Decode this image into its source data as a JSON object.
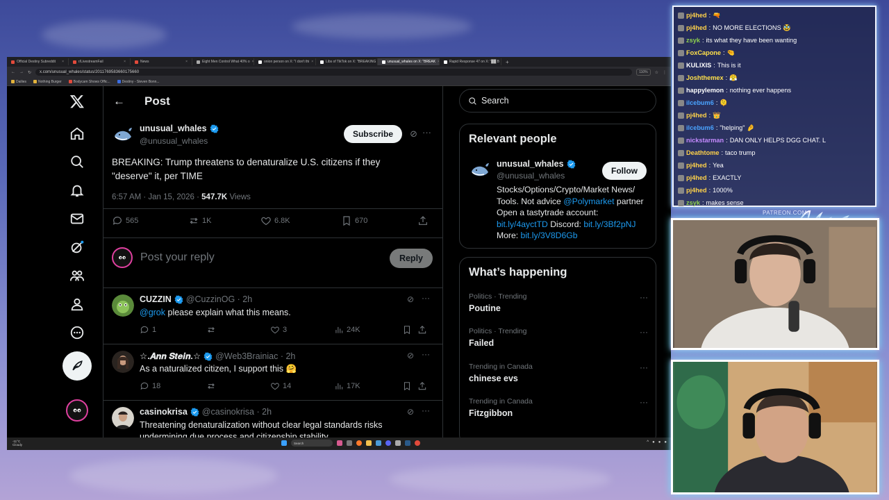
{
  "browser": {
    "tabs": [
      {
        "label": "Official Destiny Subreddit"
      },
      {
        "label": "r/LivestreamFail"
      },
      {
        "label": "News"
      },
      {
        "label": "Eight Men Control What 40% o"
      },
      {
        "label": "onion person on X: \"I don't thi"
      },
      {
        "label": "Libs of TikTok on X: \"BREAKING"
      },
      {
        "label": "unusual_whales on X: \"BREAK"
      },
      {
        "label": "Rapid Response 47 on X: \"██ B"
      }
    ],
    "url": "x.com/unusual_whales/status/2011769583660175660",
    "zoom": "110%",
    "bookmarks": [
      "Dailies",
      "Nothing Burger",
      "Bodycam Shows Offic...",
      "Destiny - Steven Bonn..."
    ]
  },
  "x": {
    "header_title": "Post",
    "post": {
      "author_name": "unusual_whales",
      "author_handle": "@unusual_whales",
      "subscribe_label": "Subscribe",
      "text": "BREAKING: Trump threatens to denaturalize U.S. citizens if they \"deserve\" it, per TIME",
      "time": "6:57 AM · Jan 15, 2026 ·",
      "views": "547.7K",
      "views_label": "Views",
      "replies": "565",
      "reposts": "1K",
      "likes": "6.8K",
      "bookmarks": "670"
    },
    "reply_placeholder": "Post your reply",
    "reply_button": "Reply",
    "replies": [
      {
        "name": "CUZZIN",
        "handle": "@CuzzinOG · 2h",
        "mention": "@grok",
        "text": " please explain what this means.",
        "replies": "1",
        "reposts": "",
        "likes": "3",
        "views": "24K"
      },
      {
        "name": "☆.𝑨𝒏𝒏 𝑺𝒕𝒆𝒊𝒏.☆",
        "handle": "@Web3Brainiac · 2h",
        "mention": "",
        "text": "As a naturalized citizen, I support this 🤗",
        "replies": "18",
        "reposts": "",
        "likes": "14",
        "views": "17K"
      },
      {
        "name": "casinokrisa",
        "handle": "@casinokrisa · 2h",
        "mention": "",
        "text": "Threatening denaturalization without clear legal standards risks undermining due process and citizenship stability",
        "replies": "",
        "reposts": "",
        "likes": "",
        "views": ""
      }
    ],
    "search_label": "Search",
    "relevant_people": {
      "title": "Relevant people",
      "name": "unusual_whales",
      "handle": "@unusual_whales",
      "follow_label": "Follow",
      "bio_1": "Stocks/Options/Crypto/Market News/ Tools. Not advice ",
      "bio_link_1": "@Polymarket",
      "bio_2": " partner Open a tastytrade account: ",
      "bio_link_2": "bit.ly/4ayctTD",
      "bio_3": " Discord: ",
      "bio_link_3": "bit.ly/3Bf2pNJ",
      "bio_4": " More: ",
      "bio_link_4": "bit.ly/3V8D6Gb"
    },
    "whats_happening": {
      "title": "What’s happening",
      "trends": [
        {
          "category": "Politics · Trending",
          "topic": "Poutine"
        },
        {
          "category": "Politics · Trending",
          "topic": "Failed"
        },
        {
          "category": "Trending in Canada",
          "topic": "chinese evs"
        },
        {
          "category": "Trending in Canada",
          "topic": "Fitzgibbon"
        }
      ]
    }
  },
  "taskbar": {
    "weather_temp": "-11°C",
    "weather_desc": "Cloudy",
    "search": "Search"
  },
  "chat": [
    {
      "user": "pj4hed",
      "msg": "🔫",
      "color": "#ffd24a"
    },
    {
      "user": "pj4hed",
      "msg": "NO MORE ELECTIONS 🥸",
      "color": "#ffd24a"
    },
    {
      "user": "zsyk",
      "msg": "its what they have been wanting",
      "color": "#8fd14f"
    },
    {
      "user": "FoxCapone",
      "msg": "🤏",
      "color": "#ffe14a"
    },
    {
      "user": "KULIXIS",
      "msg": "This is it",
      "color": "#ffffff"
    },
    {
      "user": "Joshthemex",
      "msg": "😤",
      "color": "#ffe14a"
    },
    {
      "user": "happylemon",
      "msg": "nothing ever happens",
      "color": "#ffffff"
    },
    {
      "user": "ilcebum6",
      "msg": "🫠",
      "color": "#4aa3ff"
    },
    {
      "user": "pj4hed",
      "msg": "👑",
      "color": "#ffd24a"
    },
    {
      "user": "ilcebum6",
      "msg": "\"helping\" 🤌",
      "color": "#4aa3ff"
    },
    {
      "user": "nickstarman",
      "msg": "DAN ONLY HELPS DGG CHAT. L",
      "color": "#c58bff"
    },
    {
      "user": "Deathtome",
      "msg": "taco trump",
      "color": "#ffd24a"
    },
    {
      "user": "pj4hed",
      "msg": "Yea",
      "color": "#ffd24a"
    },
    {
      "user": "pj4hed",
      "msg": "EXACTLY",
      "color": "#ffd24a"
    },
    {
      "user": "pj4hed",
      "msg": "1000%",
      "color": "#ffd24a"
    },
    {
      "user": "zsyk",
      "msg": "makes sense",
      "color": "#8fd14f"
    }
  ],
  "overlay": {
    "patreon": "PATREON.COM/"
  },
  "colors": {
    "accent": "#1d9bf0",
    "x_bg": "#000000",
    "border": "#2f3336",
    "muted": "#71767b"
  }
}
